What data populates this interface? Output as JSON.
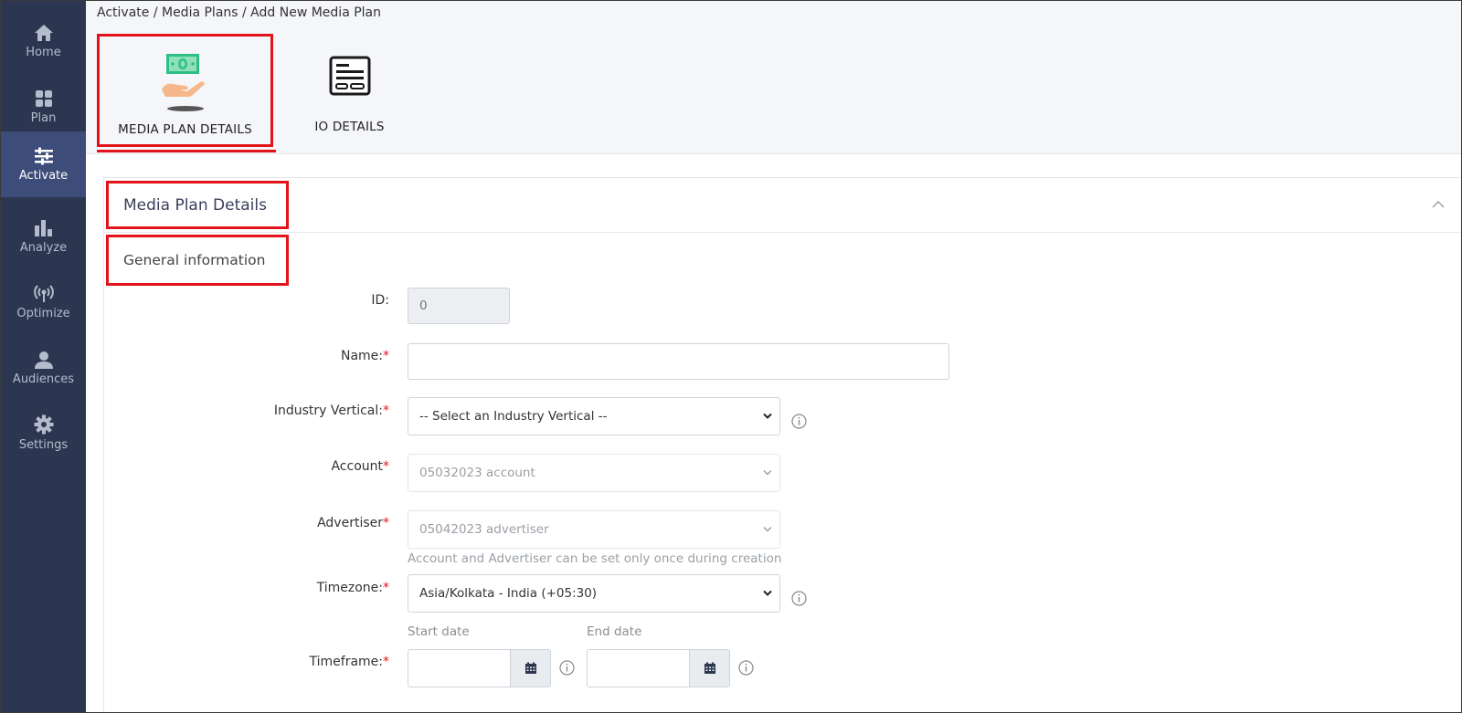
{
  "sidebar": {
    "items": [
      {
        "label": "Home",
        "icon": "home-icon"
      },
      {
        "label": "Plan",
        "icon": "grid-icon"
      },
      {
        "label": "Activate",
        "icon": "sliders-icon",
        "active": true
      },
      {
        "label": "Analyze",
        "icon": "bar-chart-icon"
      },
      {
        "label": "Optimize",
        "icon": "broadcast-icon"
      },
      {
        "label": "Audiences",
        "icon": "user-icon"
      },
      {
        "label": "Settings",
        "icon": "gear-icon"
      }
    ]
  },
  "breadcrumb": "Activate / Media Plans / Add New Media Plan",
  "steps": [
    {
      "label": "MEDIA PLAN DETAILS",
      "icon": "money-hand-icon",
      "active": true
    },
    {
      "label": "IO DETAILS",
      "icon": "document-list-icon"
    }
  ],
  "panel": {
    "title": "Media Plan Details",
    "section_title": "General information"
  },
  "form": {
    "id": {
      "label": "ID:",
      "value": "0"
    },
    "name": {
      "label": "Name:",
      "required_mark": "*",
      "value": ""
    },
    "industry_vertical": {
      "label": "Industry Vertical:",
      "required_mark": "*",
      "selected": "-- Select an Industry Vertical --"
    },
    "account": {
      "label": "Account",
      "required_mark": "*",
      "selected": "05032023 account"
    },
    "advertiser": {
      "label": "Advertiser",
      "required_mark": "*",
      "selected": "05042023 advertiser"
    },
    "account_hint": "Account and Advertiser can be set only once during creation",
    "timezone": {
      "label": "Timezone:",
      "required_mark": "*",
      "selected": "Asia/Kolkata - India (+05:30)"
    },
    "timeframe": {
      "label": "Timeframe:",
      "required_mark": "*",
      "start_label": "Start date",
      "end_label": "End date",
      "start_value": "",
      "end_value": ""
    }
  },
  "colors": {
    "sidebar_bg": "#2c3650",
    "sidebar_active": "#3d4c78",
    "highlight": "#e3131b",
    "required": "#e3131b"
  }
}
